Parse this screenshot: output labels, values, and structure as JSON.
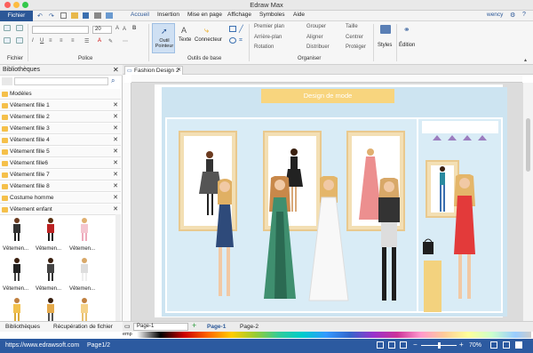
{
  "window": {
    "title": "Edraw Max",
    "user": "wency"
  },
  "menu": {
    "fichier": "Fichier",
    "accueil": "Accueil",
    "items": [
      "Insertion",
      "Mise en page",
      "Affichage",
      "Symboles",
      "Aide"
    ]
  },
  "ribbon": {
    "fichier_label": "Fichier",
    "police_label": "Police",
    "outils_label": "Outils de base",
    "organiser_label": "Organiser",
    "font_size": "20",
    "outil_pointeur": "Outil Pointeur",
    "texte": "Texte",
    "connecteur": "Connecteur",
    "premier_plan": "Premier plan",
    "arriere_plan": "Arrière-plan",
    "rotation": "Rotation",
    "grouper": "Grouper",
    "aligner": "Aligner",
    "distribuer": "Distribuer",
    "taille": "Taille",
    "centrer": "Centrer",
    "proteger": "Protéger",
    "styles": "Styles",
    "edition": "Édition"
  },
  "sidebar": {
    "title": "Bibliothèques",
    "items": [
      "Modèles",
      "Vêtement fille 1",
      "Vêtement fille 2",
      "Vêtement fille 3",
      "Vêtement fille 4",
      "Vêtement fille 5",
      "Vêtement fille6",
      "Vêtement fille 7",
      "Vêtement fille 8",
      "Costume homme",
      "Vêtement enfant"
    ],
    "shape_label": "Vêtemen..."
  },
  "tabs": {
    "doc": "Fashion Design 2"
  },
  "canvas": {
    "banner": "Design de mode"
  },
  "pages": {
    "page_select": "Page-1",
    "active": "Page-1",
    "other": "Page-2"
  },
  "bottom_tabs": {
    "libs": "Bibliothèques",
    "recovery": "Récupération de fichier"
  },
  "status": {
    "url": "https://www.edrawsoft.com",
    "page": "Page1/2",
    "zoom": "70%"
  },
  "palette_label": "emp"
}
